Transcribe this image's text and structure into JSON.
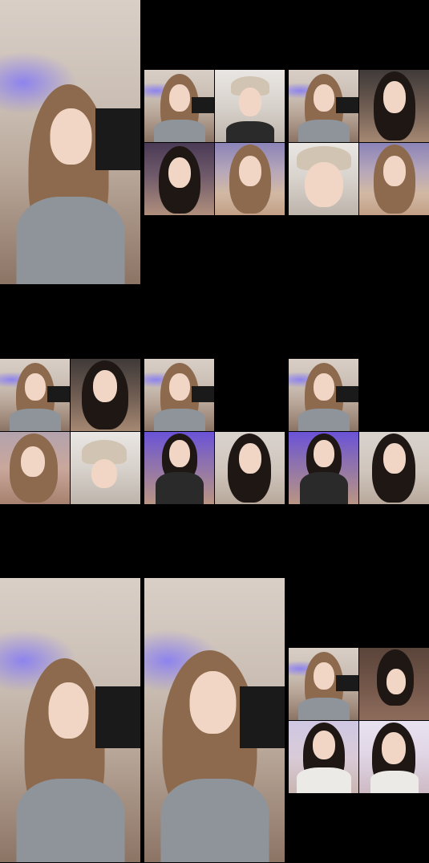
{
  "screenshot": {
    "description_text": "",
    "frames": [
      {
        "id": "frame-1",
        "kind": "single-stream"
      },
      {
        "id": "frame-2",
        "kind": "grid-2x2"
      },
      {
        "id": "frame-3",
        "kind": "grid-2x2"
      },
      {
        "id": "frame-4",
        "kind": "grid-2x2"
      },
      {
        "id": "frame-5",
        "kind": "grid-3"
      },
      {
        "id": "frame-6",
        "kind": "grid-3"
      },
      {
        "id": "frame-7",
        "kind": "single-stream"
      },
      {
        "id": "frame-8",
        "kind": "single-stream"
      },
      {
        "id": "frame-9",
        "kind": "grid-2x2"
      }
    ]
  }
}
